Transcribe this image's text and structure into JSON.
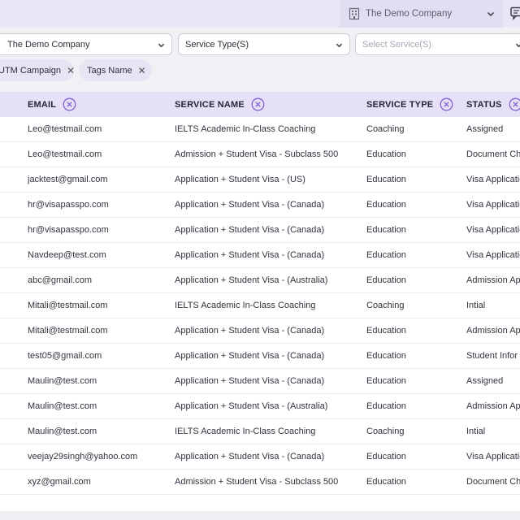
{
  "topbar": {
    "company_name": "The Demo Company"
  },
  "filters": {
    "company": "The Demo Company",
    "service_type": "Service Type(S)",
    "select_service_placeholder": "Select Service(S)"
  },
  "chips": [
    {
      "label": "UTM Campaign"
    },
    {
      "label": "Tags Name"
    }
  ],
  "table": {
    "columns": [
      "EMAIL",
      "SERVICE NAME",
      "SERVICE TYPE",
      "STATUS"
    ],
    "rows": [
      {
        "email": "Leo@testmail.com",
        "service": "IELTS Academic In-Class Coaching",
        "type": "Coaching",
        "status": "Assigned"
      },
      {
        "email": "Leo@testmail.com",
        "service": "Admission + Student Visa - Subclass 500",
        "type": "Education",
        "status": "Document Ch"
      },
      {
        "email": "jacktest@gmail.com",
        "service": "Application + Student Visa - (US)",
        "type": "Education",
        "status": "Visa Applicatio"
      },
      {
        "email": "hr@visapasspo.com",
        "service": "Application + Student Visa - (Canada)",
        "type": "Education",
        "status": "Visa Applicatio"
      },
      {
        "email": "hr@visapasspo.com",
        "service": "Application + Student Visa - (Canada)",
        "type": "Education",
        "status": "Visa Applicatio"
      },
      {
        "email": "Navdeep@test.com",
        "service": "Application + Student Visa - (Canada)",
        "type": "Education",
        "status": "Visa Applicatio"
      },
      {
        "email": "abc@gmail.com",
        "service": "Application + Student Visa - (Australia)",
        "type": "Education",
        "status": "Admission Ap"
      },
      {
        "email": "Mitali@testmail.com",
        "service": "IELTS Academic In-Class Coaching",
        "type": "Coaching",
        "status": "Intial"
      },
      {
        "email": "Mitali@testmail.com",
        "service": "Application + Student Visa - (Canada)",
        "type": "Education",
        "status": "Admission Ap"
      },
      {
        "email": "test05@gmail.com",
        "service": "Application + Student Visa - (Canada)",
        "type": "Education",
        "status": "Student Infor"
      },
      {
        "email": "Maulin@test.com",
        "service": "Application + Student Visa - (Canada)",
        "type": "Education",
        "status": "Assigned"
      },
      {
        "email": "Maulin@test.com",
        "service": "Application + Student Visa - (Australia)",
        "type": "Education",
        "status": "Admission Ap"
      },
      {
        "email": "Maulin@test.com",
        "service": "IELTS Academic In-Class Coaching",
        "type": "Coaching",
        "status": "Intial"
      },
      {
        "email": "veejay29singh@yahoo.com",
        "service": "Application + Student Visa - (Canada)",
        "type": "Education",
        "status": "Visa Applicatio"
      },
      {
        "email": "xyz@gmail.com",
        "service": "Admission + Student Visa - Subclass 500",
        "type": "Education",
        "status": "Document Ch"
      }
    ]
  },
  "colors": {
    "header_bg": "#e6e0f6",
    "accent": "#7b5fd1"
  }
}
